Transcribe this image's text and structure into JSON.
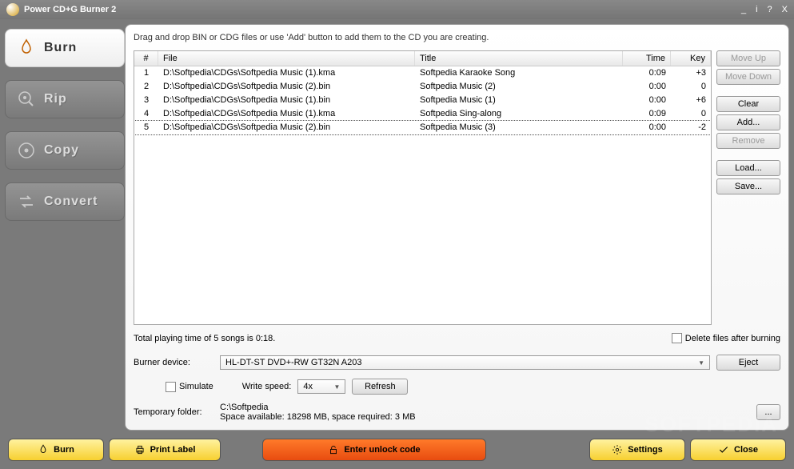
{
  "title": "Power CD+G Burner 2",
  "tabs": {
    "burn": "Burn",
    "rip": "Rip",
    "copy": "Copy",
    "convert": "Convert"
  },
  "instruction": "Drag and drop BIN or CDG files or use 'Add' button to add them to the CD you are creating.",
  "columns": {
    "num": "#",
    "file": "File",
    "title": "Title",
    "time": "Time",
    "key": "Key"
  },
  "rows": [
    {
      "num": "1",
      "file": "D:\\Softpedia\\CDGs\\Softpedia Music (1).kma",
      "title": "Softpedia Karaoke Song",
      "time": "0:09",
      "key": "+3"
    },
    {
      "num": "2",
      "file": "D:\\Softpedia\\CDGs\\Softpedia Music (2).bin",
      "title": "Softpedia Music (2)",
      "time": "0:00",
      "key": "0"
    },
    {
      "num": "3",
      "file": "D:\\Softpedia\\CDGs\\Softpedia Music (1).bin",
      "title": "Softpedia Music (1)",
      "time": "0:00",
      "key": "+6"
    },
    {
      "num": "4",
      "file": "D:\\Softpedia\\CDGs\\Softpedia Music (1).kma",
      "title": "Softpedia Sing-along",
      "time": "0:09",
      "key": "0"
    },
    {
      "num": "5",
      "file": "D:\\Softpedia\\CDGs\\Softpedia Music (2).bin",
      "title": "Softpedia Music (3)",
      "time": "0:00",
      "key": "-2"
    }
  ],
  "sideButtons": {
    "moveUp": "Move Up",
    "moveDown": "Move Down",
    "clear": "Clear",
    "add": "Add...",
    "remove": "Remove",
    "load": "Load...",
    "save": "Save..."
  },
  "totalText": "Total playing time of 5 songs is 0:18.",
  "deleteAfter": "Delete files after burning",
  "burnerLabel": "Burner device:",
  "burnerValue": "HL-DT-ST DVD+-RW GT32N    A203",
  "eject": "Eject",
  "simulate": "Simulate",
  "writeSpeedLabel": "Write speed:",
  "writeSpeedValue": "4x",
  "refresh": "Refresh",
  "tempFolderLabel": "Temporary folder:",
  "tempFolderValue": "C:\\Softpedia",
  "spaceText": "Space available: 18298 MB, space required: 3 MB",
  "browse": "...",
  "bottom": {
    "burn": "Burn",
    "printLabel": "Print Label",
    "unlock": "Enter unlock code",
    "settings": "Settings",
    "close": "Close"
  },
  "watermark": "SOFTPEDIA"
}
